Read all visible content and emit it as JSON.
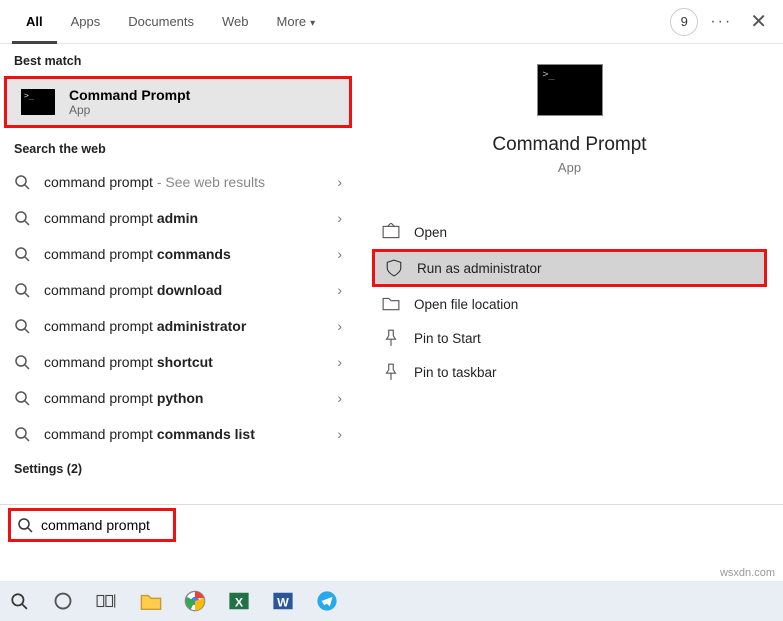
{
  "tabs": {
    "all": "All",
    "apps": "Apps",
    "documents": "Documents",
    "web": "Web",
    "more": "More"
  },
  "badge": "9",
  "sections": {
    "best": "Best match",
    "web": "Search the web",
    "settings": "Settings (2)"
  },
  "bestMatch": {
    "title": "Command Prompt",
    "subtitle": "App"
  },
  "webResults": [
    {
      "prefix": "command prompt",
      "bold": "",
      "suffix": " - See web results"
    },
    {
      "prefix": "command prompt ",
      "bold": "admin",
      "suffix": ""
    },
    {
      "prefix": "command prompt ",
      "bold": "commands",
      "suffix": ""
    },
    {
      "prefix": "command prompt ",
      "bold": "download",
      "suffix": ""
    },
    {
      "prefix": "command prompt ",
      "bold": "administrator",
      "suffix": ""
    },
    {
      "prefix": "command prompt ",
      "bold": "shortcut",
      "suffix": ""
    },
    {
      "prefix": "command prompt ",
      "bold": "python",
      "suffix": ""
    },
    {
      "prefix": "command prompt ",
      "bold": "commands list",
      "suffix": ""
    }
  ],
  "preview": {
    "title": "Command Prompt",
    "subtitle": "App"
  },
  "actions": {
    "open": "Open",
    "runAdmin": "Run as administrator",
    "openLoc": "Open file location",
    "pinStart": "Pin to Start",
    "pinTaskbar": "Pin to taskbar"
  },
  "searchValue": "command prompt",
  "watermark": "wsxdn.com"
}
